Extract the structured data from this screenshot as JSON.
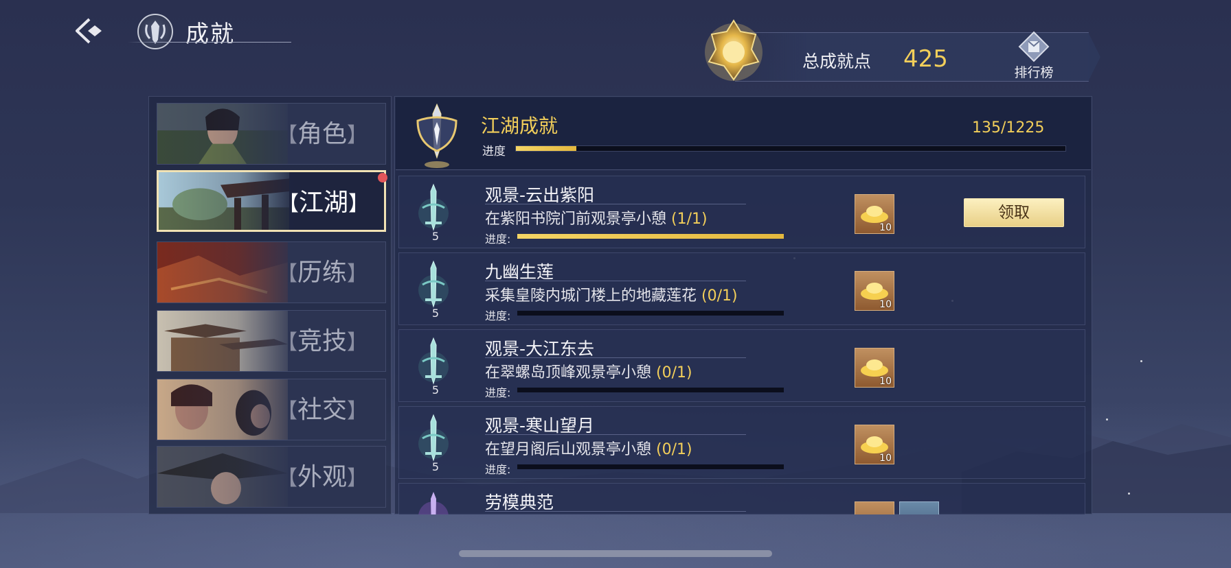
{
  "header": {
    "title": "成就",
    "points_label": "总成就点",
    "points_value": "425",
    "rank_label": "排行榜"
  },
  "categories": [
    {
      "label": "角色",
      "active": false
    },
    {
      "label": "江湖",
      "active": true,
      "has_notification": true
    },
    {
      "label": "历练",
      "active": false
    },
    {
      "label": "竞技",
      "active": false
    },
    {
      "label": "社交",
      "active": false
    },
    {
      "label": "外观",
      "active": false
    }
  ],
  "bracket_left": "【",
  "bracket_right": "】",
  "section": {
    "title": "江湖成就",
    "count": "135/1225",
    "progress_label": "进度",
    "progress_fraction": 0.11
  },
  "achievements": [
    {
      "name": "观景-云出紫阳",
      "desc": "在紫阳书院门前观景亭小憩",
      "count": "(1/1)",
      "progress_label": "进度:",
      "progress": 1.0,
      "level": "5",
      "reward_qty": "10",
      "claim_label": "领取",
      "claimable": true
    },
    {
      "name": "九幽生莲",
      "desc": "采集皇陵内城门楼上的地藏莲花",
      "count": "(0/1)",
      "progress_label": "进度:",
      "progress": 0.0,
      "level": "5",
      "reward_qty": "10",
      "claimable": false
    },
    {
      "name": "观景-大江东去",
      "desc": "在翠螺岛顶峰观景亭小憩",
      "count": "(0/1)",
      "progress_label": "进度:",
      "progress": 0.0,
      "level": "5",
      "reward_qty": "10",
      "claimable": false
    },
    {
      "name": "观景-寒山望月",
      "desc": "在望月阁后山观景亭小憩",
      "count": "(0/1)",
      "progress_label": "进度:",
      "progress": 0.0,
      "level": "5",
      "reward_qty": "10",
      "claimable": false
    },
    {
      "name": "劳模典范"
    }
  ],
  "colors": {
    "accent_gold": "#f3cf5a",
    "claim_button": "#e8cf86",
    "notification": "#e2555a"
  }
}
